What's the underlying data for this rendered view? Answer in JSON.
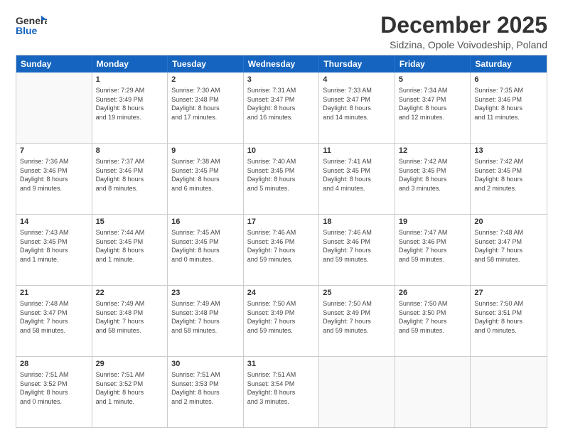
{
  "header": {
    "logo_general": "General",
    "logo_blue": "Blue",
    "month_title": "December 2025",
    "subtitle": "Sidzina, Opole Voivodeship, Poland"
  },
  "days_of_week": [
    "Sunday",
    "Monday",
    "Tuesday",
    "Wednesday",
    "Thursday",
    "Friday",
    "Saturday"
  ],
  "weeks": [
    [
      {
        "day": "",
        "info": ""
      },
      {
        "day": "1",
        "info": "Sunrise: 7:29 AM\nSunset: 3:49 PM\nDaylight: 8 hours\nand 19 minutes."
      },
      {
        "day": "2",
        "info": "Sunrise: 7:30 AM\nSunset: 3:48 PM\nDaylight: 8 hours\nand 17 minutes."
      },
      {
        "day": "3",
        "info": "Sunrise: 7:31 AM\nSunset: 3:47 PM\nDaylight: 8 hours\nand 16 minutes."
      },
      {
        "day": "4",
        "info": "Sunrise: 7:33 AM\nSunset: 3:47 PM\nDaylight: 8 hours\nand 14 minutes."
      },
      {
        "day": "5",
        "info": "Sunrise: 7:34 AM\nSunset: 3:47 PM\nDaylight: 8 hours\nand 12 minutes."
      },
      {
        "day": "6",
        "info": "Sunrise: 7:35 AM\nSunset: 3:46 PM\nDaylight: 8 hours\nand 11 minutes."
      }
    ],
    [
      {
        "day": "7",
        "info": "Sunrise: 7:36 AM\nSunset: 3:46 PM\nDaylight: 8 hours\nand 9 minutes."
      },
      {
        "day": "8",
        "info": "Sunrise: 7:37 AM\nSunset: 3:46 PM\nDaylight: 8 hours\nand 8 minutes."
      },
      {
        "day": "9",
        "info": "Sunrise: 7:38 AM\nSunset: 3:45 PM\nDaylight: 8 hours\nand 6 minutes."
      },
      {
        "day": "10",
        "info": "Sunrise: 7:40 AM\nSunset: 3:45 PM\nDaylight: 8 hours\nand 5 minutes."
      },
      {
        "day": "11",
        "info": "Sunrise: 7:41 AM\nSunset: 3:45 PM\nDaylight: 8 hours\nand 4 minutes."
      },
      {
        "day": "12",
        "info": "Sunrise: 7:42 AM\nSunset: 3:45 PM\nDaylight: 8 hours\nand 3 minutes."
      },
      {
        "day": "13",
        "info": "Sunrise: 7:42 AM\nSunset: 3:45 PM\nDaylight: 8 hours\nand 2 minutes."
      }
    ],
    [
      {
        "day": "14",
        "info": "Sunrise: 7:43 AM\nSunset: 3:45 PM\nDaylight: 8 hours\nand 1 minute."
      },
      {
        "day": "15",
        "info": "Sunrise: 7:44 AM\nSunset: 3:45 PM\nDaylight: 8 hours\nand 1 minute."
      },
      {
        "day": "16",
        "info": "Sunrise: 7:45 AM\nSunset: 3:45 PM\nDaylight: 8 hours\nand 0 minutes."
      },
      {
        "day": "17",
        "info": "Sunrise: 7:46 AM\nSunset: 3:46 PM\nDaylight: 7 hours\nand 59 minutes."
      },
      {
        "day": "18",
        "info": "Sunrise: 7:46 AM\nSunset: 3:46 PM\nDaylight: 7 hours\nand 59 minutes."
      },
      {
        "day": "19",
        "info": "Sunrise: 7:47 AM\nSunset: 3:46 PM\nDaylight: 7 hours\nand 59 minutes."
      },
      {
        "day": "20",
        "info": "Sunrise: 7:48 AM\nSunset: 3:47 PM\nDaylight: 7 hours\nand 58 minutes."
      }
    ],
    [
      {
        "day": "21",
        "info": "Sunrise: 7:48 AM\nSunset: 3:47 PM\nDaylight: 7 hours\nand 58 minutes."
      },
      {
        "day": "22",
        "info": "Sunrise: 7:49 AM\nSunset: 3:48 PM\nDaylight: 7 hours\nand 58 minutes."
      },
      {
        "day": "23",
        "info": "Sunrise: 7:49 AM\nSunset: 3:48 PM\nDaylight: 7 hours\nand 58 minutes."
      },
      {
        "day": "24",
        "info": "Sunrise: 7:50 AM\nSunset: 3:49 PM\nDaylight: 7 hours\nand 59 minutes."
      },
      {
        "day": "25",
        "info": "Sunrise: 7:50 AM\nSunset: 3:49 PM\nDaylight: 7 hours\nand 59 minutes."
      },
      {
        "day": "26",
        "info": "Sunrise: 7:50 AM\nSunset: 3:50 PM\nDaylight: 7 hours\nand 59 minutes."
      },
      {
        "day": "27",
        "info": "Sunrise: 7:50 AM\nSunset: 3:51 PM\nDaylight: 8 hours\nand 0 minutes."
      }
    ],
    [
      {
        "day": "28",
        "info": "Sunrise: 7:51 AM\nSunset: 3:52 PM\nDaylight: 8 hours\nand 0 minutes."
      },
      {
        "day": "29",
        "info": "Sunrise: 7:51 AM\nSunset: 3:52 PM\nDaylight: 8 hours\nand 1 minute."
      },
      {
        "day": "30",
        "info": "Sunrise: 7:51 AM\nSunset: 3:53 PM\nDaylight: 8 hours\nand 2 minutes."
      },
      {
        "day": "31",
        "info": "Sunrise: 7:51 AM\nSunset: 3:54 PM\nDaylight: 8 hours\nand 3 minutes."
      },
      {
        "day": "",
        "info": ""
      },
      {
        "day": "",
        "info": ""
      },
      {
        "day": "",
        "info": ""
      }
    ]
  ]
}
